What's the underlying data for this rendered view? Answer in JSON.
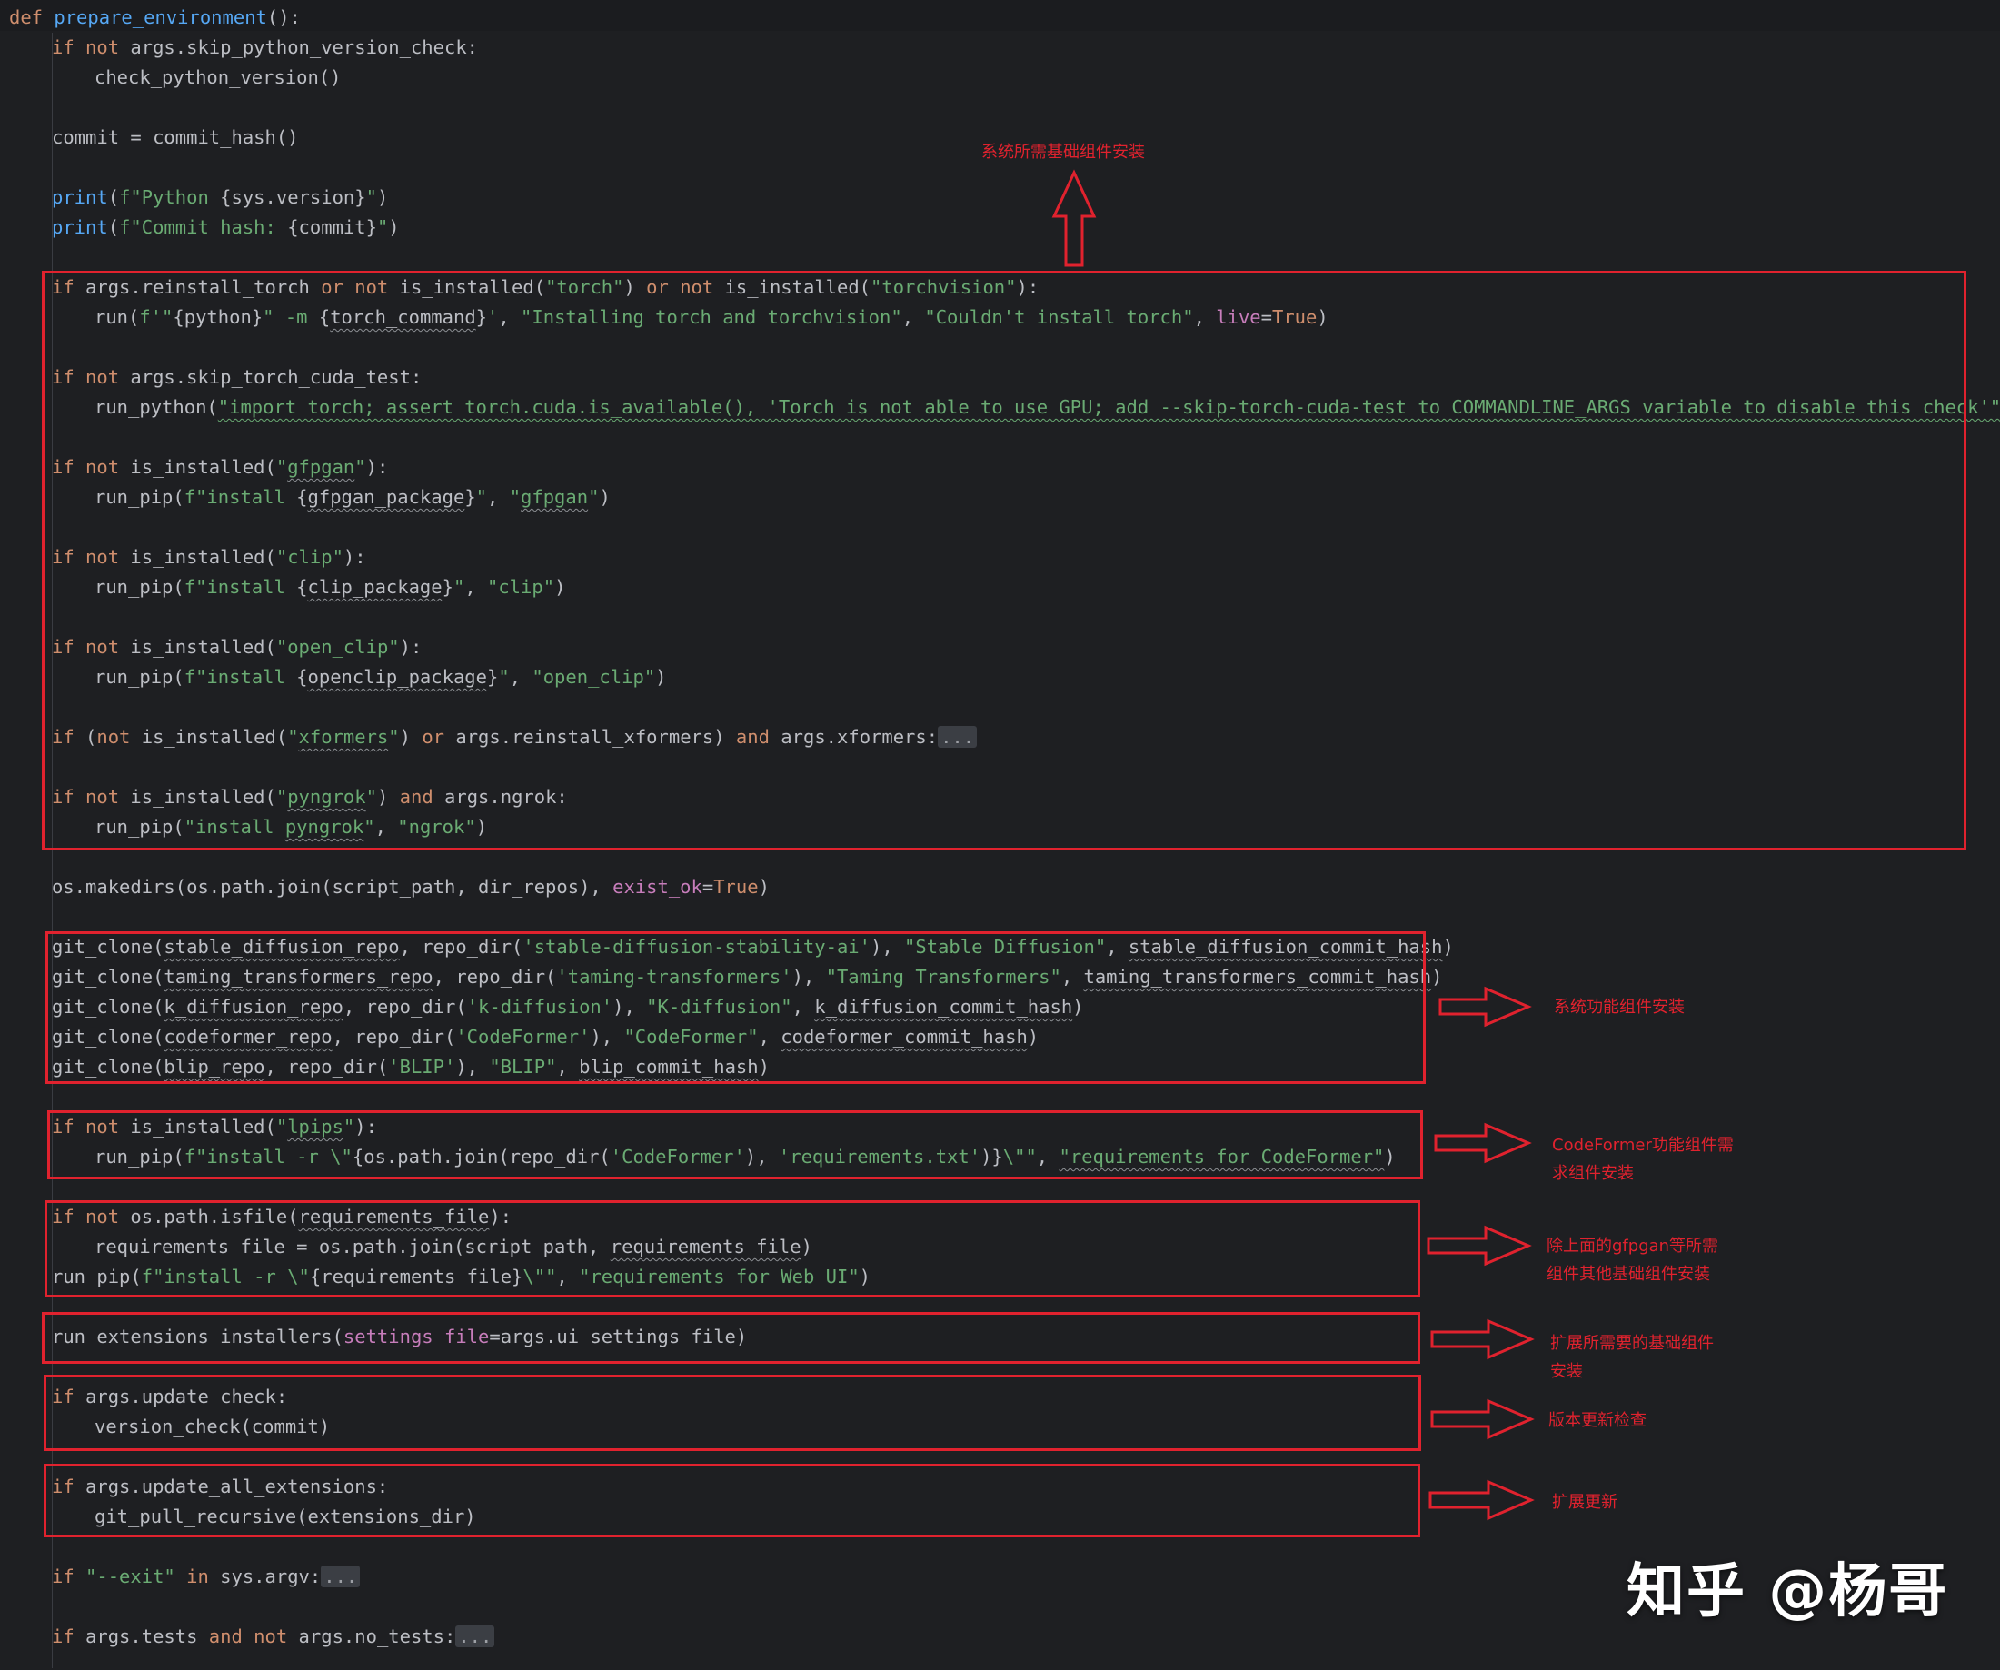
{
  "code": {
    "def_keyword": "def",
    "function_name": "prepare_environment",
    "lines": [
      {
        "text": "():"
      },
      {
        "text": "if not args.skip_python_version_check:"
      },
      {
        "text": "check_python_version()"
      },
      {
        "text": "commit = commit_hash()"
      },
      {
        "text": "print(f\"Python {sys.version}\")"
      },
      {
        "text": "print(f\"Commit hash: {commit}\")"
      },
      {
        "text": "if args.reinstall_torch or not is_installed(\"torch\") or not is_installed(\"torchvision\"):"
      },
      {
        "text": "run(f'\"{python}\" -m {torch_command}', \"Installing torch and torchvision\", \"Couldn't install torch\", live=True)"
      },
      {
        "text": "if not args.skip_torch_cuda_test:"
      },
      {
        "text": "run_python(\"import torch; assert torch.cuda.is_available(), 'Torch is not able to use GPU; add --skip-torch-cuda-test to COMMANDLINE_ARGS variable to disable this check'\")"
      },
      {
        "text": "if not is_installed(\"gfpgan\"):"
      },
      {
        "text": "run_pip(f\"install {gfpgan_package}\", \"gfpgan\")"
      },
      {
        "text": "if not is_installed(\"clip\"):"
      },
      {
        "text": "run_pip(f\"install {clip_package}\", \"clip\")"
      },
      {
        "text": "if not is_installed(\"open_clip\"):"
      },
      {
        "text": "run_pip(f\"install {openclip_package}\", \"open_clip\")"
      },
      {
        "text": "if (not is_installed(\"xformers\") or args.reinstall_xformers) and args.xformers:..."
      },
      {
        "text": "if not is_installed(\"pyngrok\") and args.ngrok:"
      },
      {
        "text": "run_pip(\"install pyngrok\", \"ngrok\")"
      },
      {
        "text": "os.makedirs(os.path.join(script_path, dir_repos), exist_ok=True)"
      },
      {
        "text": "git_clone(stable_diffusion_repo, repo_dir('stable-diffusion-stability-ai'), \"Stable Diffusion\", stable_diffusion_commit_hash)"
      },
      {
        "text": "git_clone(taming_transformers_repo, repo_dir('taming-transformers'), \"Taming Transformers\", taming_transformers_commit_hash)"
      },
      {
        "text": "git_clone(k_diffusion_repo, repo_dir('k-diffusion'), \"K-diffusion\", k_diffusion_commit_hash)"
      },
      {
        "text": "git_clone(codeformer_repo, repo_dir('CodeFormer'), \"CodeFormer\", codeformer_commit_hash)"
      },
      {
        "text": "git_clone(blip_repo, repo_dir('BLIP'), \"BLIP\", blip_commit_hash)"
      },
      {
        "text": "if not is_installed(\"lpips\"):"
      },
      {
        "text": "run_pip(f\"install -r \\\"{os.path.join(repo_dir('CodeFormer'), 'requirements.txt')}\\\"\", \"requirements for CodeFormer\")"
      },
      {
        "text": "if not os.path.isfile(requirements_file):"
      },
      {
        "text": "requirements_file = os.path.join(script_path, requirements_file)"
      },
      {
        "text": "run_pip(f\"install -r \\\"{requirements_file}\\\"\", \"requirements for Web UI\")"
      },
      {
        "text": "run_extensions_installers(settings_file=args.ui_settings_file)"
      },
      {
        "text": "if args.update_check:"
      },
      {
        "text": "version_check(commit)"
      },
      {
        "text": "if args.update_all_extensions:"
      },
      {
        "text": "git_pull_recursive(extensions_dir)"
      },
      {
        "text": "if \"--exit\" in sys.argv:..."
      },
      {
        "text": "if args.tests and not args.no_tests:..."
      }
    ]
  },
  "annotations": [
    {
      "id": "base",
      "text": "系统所需基础组件安装"
    },
    {
      "id": "func",
      "text": "系统功能组件安装"
    },
    {
      "id": "codeformer",
      "text": "CodeFormer功能组件需求组件安装"
    },
    {
      "id": "other",
      "text": "除上面的gfpgan等所需组件其他基础组件安装"
    },
    {
      "id": "ext",
      "text": "扩展所需要的基础组件安装"
    },
    {
      "id": "version",
      "text": "版本更新检查"
    },
    {
      "id": "ext-update",
      "text": "扩展更新"
    }
  ],
  "watermark": "知乎 @杨哥",
  "colors": {
    "background": "#1e1f22",
    "keyword": "#cf8e6d",
    "function": "#56a8f5",
    "string": "#6aab73",
    "parameter": "#c77dbb",
    "default_text": "#bcbec4",
    "annotation": "#e0222e"
  }
}
